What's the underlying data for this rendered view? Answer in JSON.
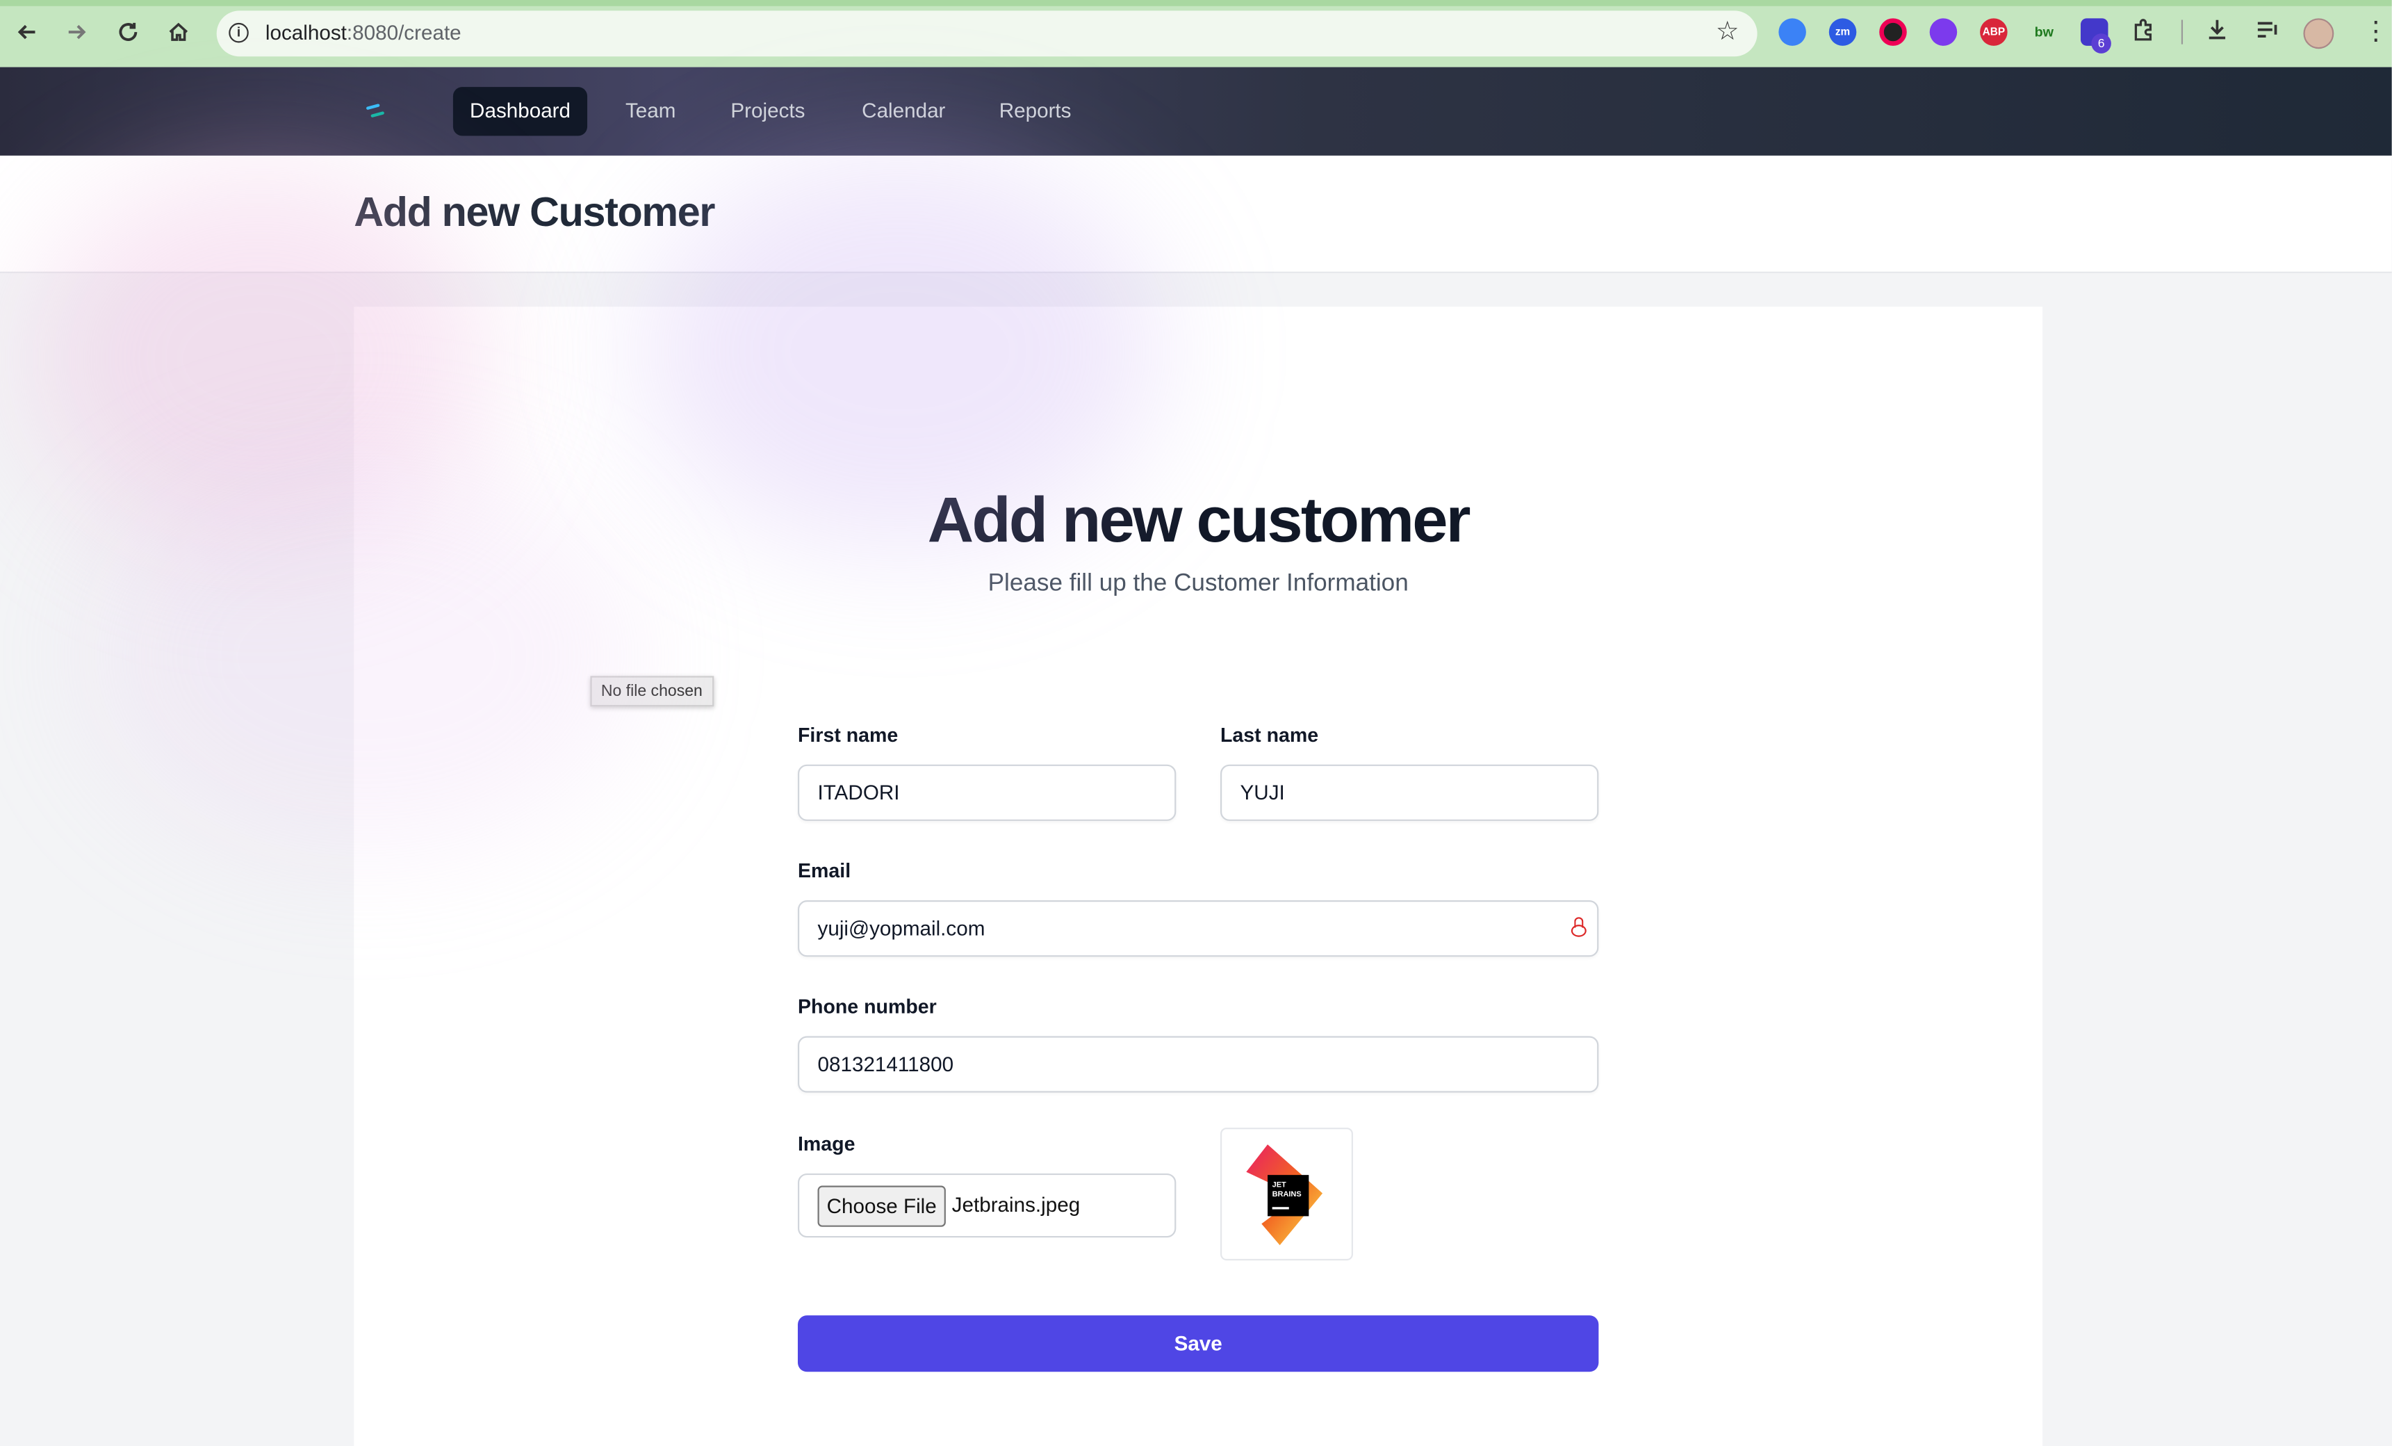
{
  "browser": {
    "url_host": "localhost",
    "url_rest": ":8080/create",
    "extension_badge": "6",
    "extensions": [
      "zm",
      "ABP",
      "bw"
    ]
  },
  "nav": {
    "items": [
      {
        "label": "Dashboard",
        "active": true
      },
      {
        "label": "Team",
        "active": false
      },
      {
        "label": "Projects",
        "active": false
      },
      {
        "label": "Calendar",
        "active": false
      },
      {
        "label": "Reports",
        "active": false
      }
    ]
  },
  "page": {
    "header_title": "Add new Customer"
  },
  "form": {
    "title": "Add new customer",
    "subtitle": "Please fill up the Customer Information",
    "tooltip": "No file chosen",
    "first_name_label": "First name",
    "first_name_value": "ITADORI",
    "last_name_label": "Last name",
    "last_name_value": "YUJI",
    "email_label": "Email",
    "email_value": "yuji@yopmail.com",
    "phone_label": "Phone number",
    "phone_value": "081321411800",
    "image_label": "Image",
    "choose_file_label": "Choose File",
    "file_name": "Jetbrains.jpeg",
    "preview_logo_text": "JET BRAINS",
    "save_label": "Save"
  },
  "colors": {
    "primary": "#4f46e5",
    "nav_bg": "#1f2937",
    "chrome_bg": "#c5e6c0"
  }
}
